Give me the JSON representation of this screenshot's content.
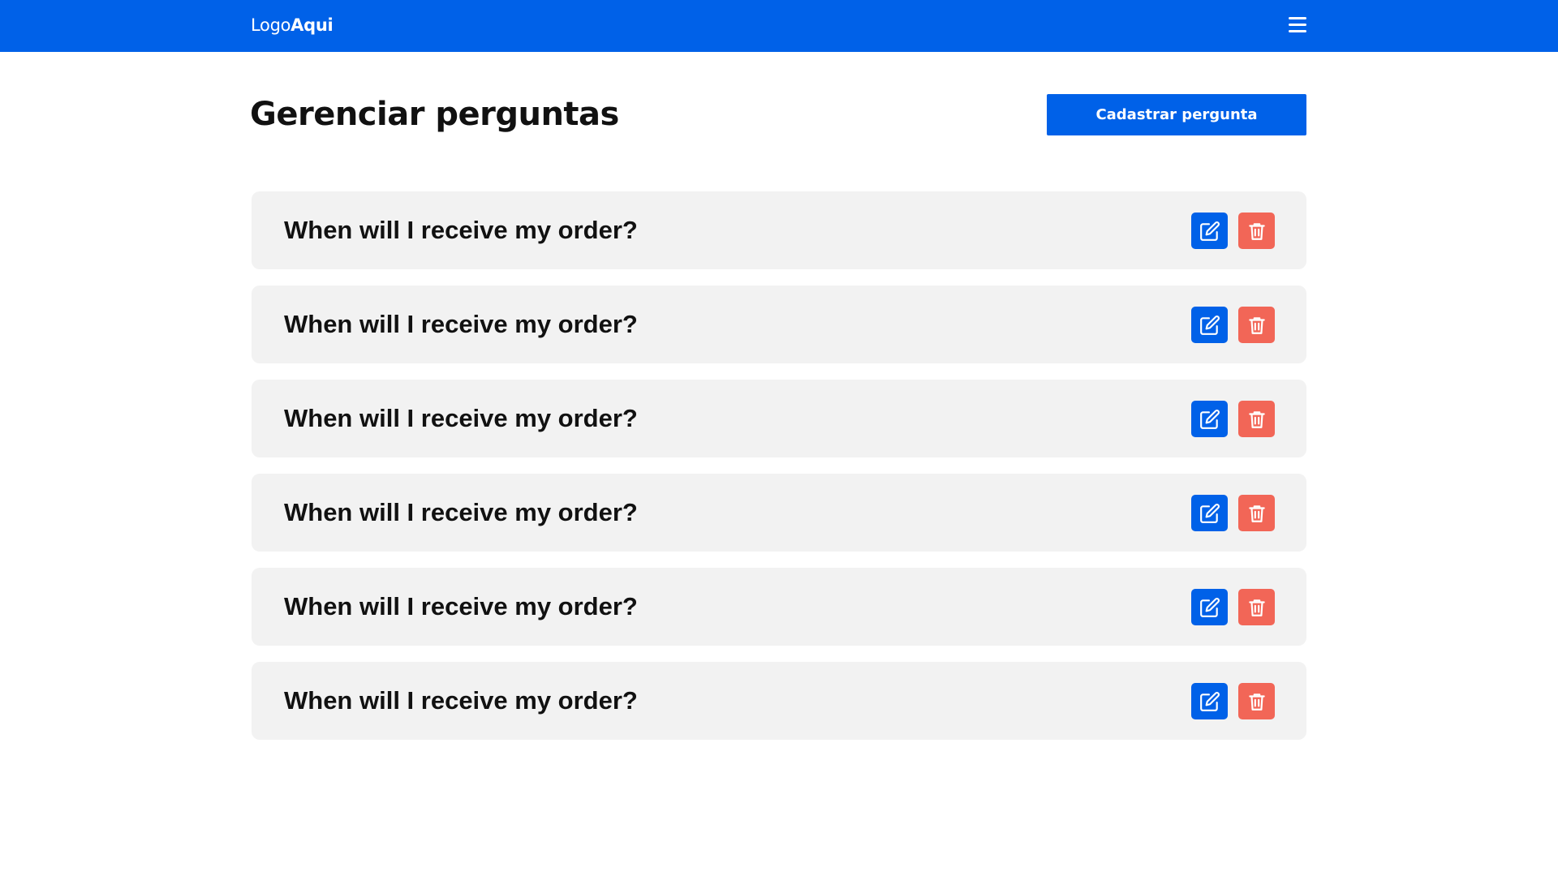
{
  "header": {
    "logo_light": "Logo",
    "logo_bold": "Aqui",
    "menu_icon": "hamburger-menu-icon"
  },
  "main": {
    "title": "Gerenciar perguntas",
    "add_button_label": "Cadastrar pergunta"
  },
  "questions": [
    {
      "text": "When will I receive my order?"
    },
    {
      "text": "When will I receive my order?"
    },
    {
      "text": "When will I receive my order?"
    },
    {
      "text": "When will I receive my order?"
    },
    {
      "text": "When will I receive my order?"
    },
    {
      "text": "When will I receive my order?"
    }
  ],
  "actions": {
    "edit_icon": "edit-icon",
    "delete_icon": "trash-icon"
  },
  "colors": {
    "primary": "#0061e8",
    "danger": "#f26657",
    "card_bg": "#f2f2f2",
    "text": "#111111"
  }
}
